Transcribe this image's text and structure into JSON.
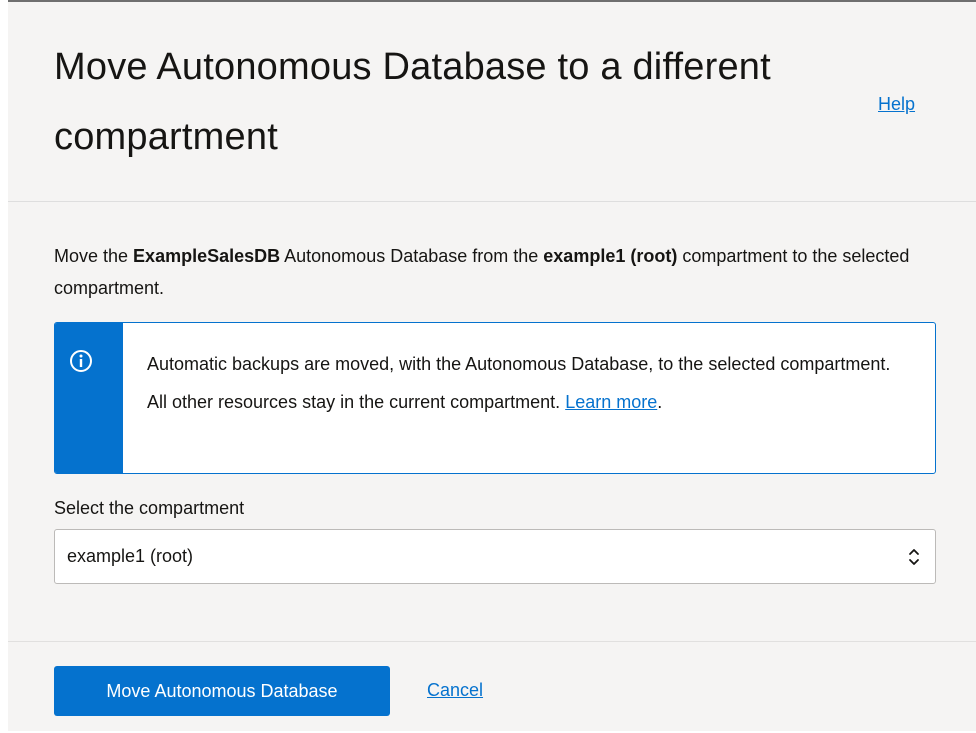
{
  "dialog": {
    "title": "Move Autonomous Database to a different compartment",
    "help_label": "Help"
  },
  "description": {
    "prefix": "Move the ",
    "database_name": "ExampleSalesDB",
    "middle": " Autonomous Database from the ",
    "current_compartment": "example1 (root)",
    "suffix": " compartment to the selected compartment."
  },
  "info": {
    "icon": "info-icon",
    "text": "Automatic backups are moved, with the Autonomous Database, to the selected compartment. All other resources stay in the current compartment. ",
    "link_label": "Learn more",
    "after_link": "."
  },
  "compartment_select": {
    "label": "Select the compartment",
    "value": "example1 (root)",
    "icon": "select-arrows-icon"
  },
  "footer": {
    "primary_label": "Move Autonomous Database",
    "cancel_label": "Cancel"
  },
  "colors": {
    "accent": "#0572ce",
    "panel_background": "#f5f4f3",
    "text": "#161513"
  }
}
